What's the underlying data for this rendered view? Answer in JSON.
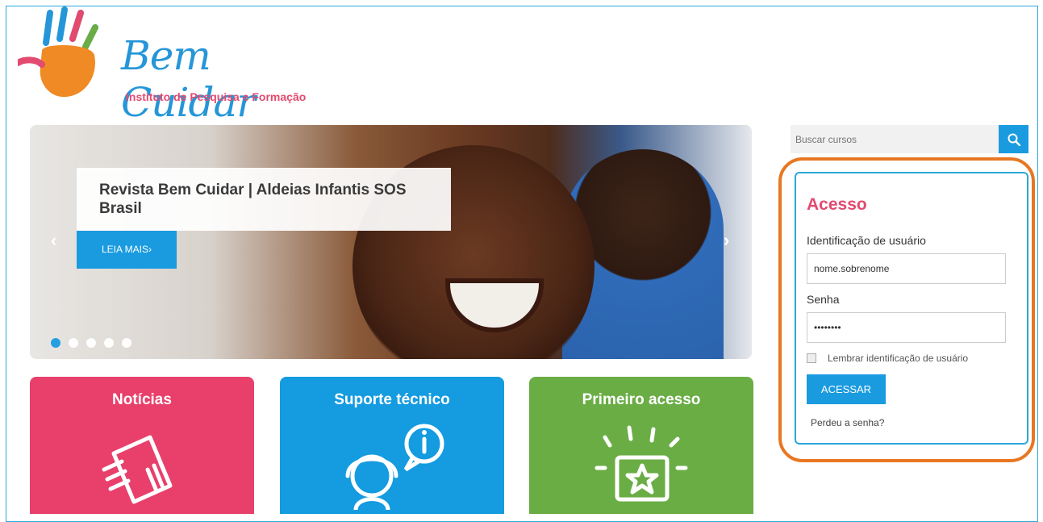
{
  "brand": {
    "name": "Bem Cuidar",
    "subtitle": "Instituto de Pesquisa e Formação"
  },
  "slider": {
    "caption": "Revista Bem Cuidar | Aldeias Infantis SOS Brasil",
    "read_more": "LEIA MAIS›",
    "prev_arrow": "‹",
    "next_arrow": "›",
    "slide_count": 5,
    "active_slide": 1
  },
  "tiles": [
    {
      "title": "Notícias",
      "color": "#e8406b",
      "icon": "newspaper-icon"
    },
    {
      "title": "Suporte técnico",
      "color": "#149be0",
      "icon": "support-headset-icon"
    },
    {
      "title": "Primeiro acesso",
      "color": "#6aad45",
      "icon": "star-screen-icon"
    }
  ],
  "search": {
    "placeholder": "Buscar cursos",
    "icon": "search-icon"
  },
  "login": {
    "title": "Acesso",
    "username_label": "Identificação de usuário",
    "username_value": "nome.sobrenome",
    "password_label": "Senha",
    "password_value": "••••••••",
    "remember_label": "Lembrar identificação de usuário",
    "submit_label": "ACESSAR",
    "forgot_label": "Perdeu a senha?"
  },
  "colors": {
    "accent_blue": "#1a9be0",
    "pink": "#e34a6f",
    "highlight_orange": "#e87722"
  }
}
